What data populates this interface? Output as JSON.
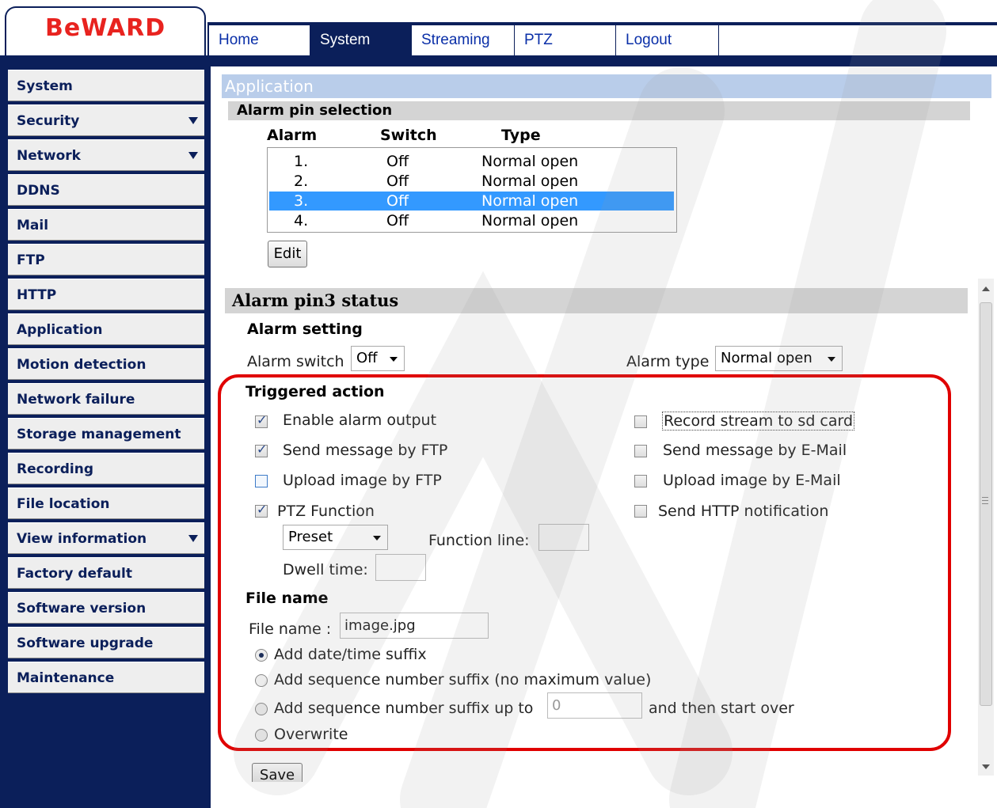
{
  "brand": {
    "logo": "BeWARD",
    "logo_color": "#e8231f",
    "nav_color": "#0b1f5a"
  },
  "top_nav": [
    {
      "label": "Home",
      "active": false
    },
    {
      "label": "System",
      "active": true
    },
    {
      "label": "Streaming",
      "active": false
    },
    {
      "label": "PTZ",
      "active": false
    },
    {
      "label": "Logout",
      "active": false
    }
  ],
  "sidebar": [
    {
      "label": "System",
      "has_submenu": false
    },
    {
      "label": "Security",
      "has_submenu": true
    },
    {
      "label": "Network",
      "has_submenu": true
    },
    {
      "label": "DDNS",
      "has_submenu": false
    },
    {
      "label": "Mail",
      "has_submenu": false
    },
    {
      "label": "FTP",
      "has_submenu": false
    },
    {
      "label": "HTTP",
      "has_submenu": false
    },
    {
      "label": "Application",
      "has_submenu": false
    },
    {
      "label": "Motion detection",
      "has_submenu": false
    },
    {
      "label": "Network failure detection",
      "has_submenu": false
    },
    {
      "label": "Storage management",
      "has_submenu": false
    },
    {
      "label": "Recording",
      "has_submenu": false
    },
    {
      "label": "File location",
      "has_submenu": false
    },
    {
      "label": "View information",
      "has_submenu": true
    },
    {
      "label": "Factory default",
      "has_submenu": false
    },
    {
      "label": "Software version",
      "has_submenu": false
    },
    {
      "label": "Software upgrade",
      "has_submenu": false
    },
    {
      "label": "Maintenance",
      "has_submenu": false
    }
  ],
  "page_title": "Application",
  "alarm_selection": {
    "title": "Alarm pin selection",
    "columns": [
      "Alarm",
      "Switch",
      "Type"
    ],
    "rows": [
      {
        "alarm": "1.",
        "switch": "Off",
        "type": "Normal open",
        "selected": false
      },
      {
        "alarm": "2.",
        "switch": "Off",
        "type": "Normal open",
        "selected": false
      },
      {
        "alarm": "3.",
        "switch": "Off",
        "type": "Normal open",
        "selected": true
      },
      {
        "alarm": "4.",
        "switch": "Off",
        "type": "Normal open",
        "selected": false
      }
    ],
    "edit_label": "Edit"
  },
  "status": {
    "title": "Alarm pin3 status",
    "alarm_setting_title": "Alarm setting",
    "alarm_switch_label": "Alarm switch",
    "alarm_switch_value": "Off",
    "alarm_type_label": "Alarm type",
    "alarm_type_value": "Normal open"
  },
  "triggered": {
    "title": "Triggered action",
    "enable_alarm_output": {
      "label": "Enable alarm output",
      "checked": true
    },
    "send_ftp": {
      "label": "Send message by FTP",
      "checked": true
    },
    "upload_ftp": {
      "label": "Upload image by FTP",
      "checked": false
    },
    "ptz_function": {
      "label": "PTZ Function",
      "checked": true
    },
    "record_sd": {
      "label": "Record stream to sd card",
      "checked": false
    },
    "send_email": {
      "label": "Send message by E-Mail",
      "checked": false
    },
    "upload_email": {
      "label": "Upload image by E-Mail",
      "checked": false
    },
    "send_http": {
      "label": "Send HTTP notification",
      "checked": false
    },
    "preset_value": "Preset",
    "function_line_label": "Function line:",
    "function_line_value": "",
    "dwell_time_label": "Dwell time:",
    "dwell_time_value": ""
  },
  "file_name": {
    "title": "File name",
    "label": "File name :",
    "value": "image.jpg",
    "options": [
      {
        "label": "Add date/time suffix",
        "selected": true
      },
      {
        "label": "Add sequence number suffix (no maximum value)",
        "selected": false
      },
      {
        "label": "Add sequence number suffix up to",
        "selected": false
      },
      {
        "label": "Overwrite",
        "selected": false
      }
    ],
    "seq_max_value": "0",
    "start_over_label": "and then start over"
  },
  "save_label": "Save"
}
